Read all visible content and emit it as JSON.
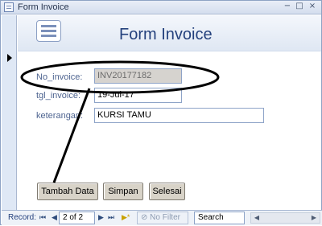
{
  "window": {
    "title": "Form Invoice"
  },
  "header": {
    "title": "Form Invoice"
  },
  "fields": {
    "invoice_label": "No_invoice:",
    "invoice_value": "INV20177182",
    "date_label": "tgl_invoice:",
    "date_value": "19-Jul-17",
    "note_label": "keterangan:",
    "note_value": "KURSI TAMU"
  },
  "buttons": {
    "add": "Tambah Data",
    "save": "Simpan",
    "finish": "Selesai"
  },
  "navigation": {
    "record_label": "Record:",
    "position": "2 of 2",
    "filter": "No Filter",
    "search": "Search"
  },
  "icons": {
    "form_icon": "form-icon",
    "record_pointer": "record-pointer-icon",
    "first": "first-record-icon",
    "previous": "previous-record-icon",
    "next": "next-record-icon",
    "last": "last-record-icon",
    "new": "new-record-icon",
    "filter": "filter-icon"
  },
  "colors": {
    "title_blue": "#24417d",
    "label_blue": "#4e6490",
    "readonly_field": "#d6d3cf"
  }
}
